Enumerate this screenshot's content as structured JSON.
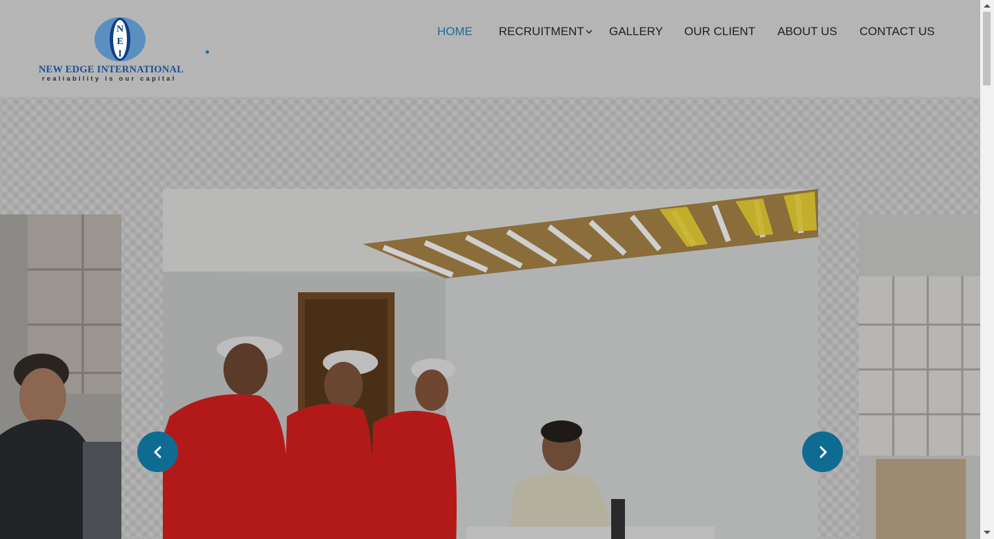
{
  "brand": {
    "name": "NEW EDGE INTERNATIONAL",
    "tagline": "realiability is our capital",
    "monogram": "NEI",
    "color": "#1b4f93"
  },
  "nav": {
    "items": [
      {
        "label": "HOME",
        "active": true
      },
      {
        "label": "RECRUITMENT",
        "has_dropdown": true
      },
      {
        "label": "GALLERY"
      },
      {
        "label": "OUR CLIENT"
      },
      {
        "label": "ABOUT US"
      },
      {
        "label": "CONTACT US"
      }
    ],
    "active_color": "#1a6e95"
  },
  "carousel": {
    "prev_icon": "chevron-left-icon",
    "next_icon": "chevron-right-icon",
    "accent": "#0e6c93"
  }
}
